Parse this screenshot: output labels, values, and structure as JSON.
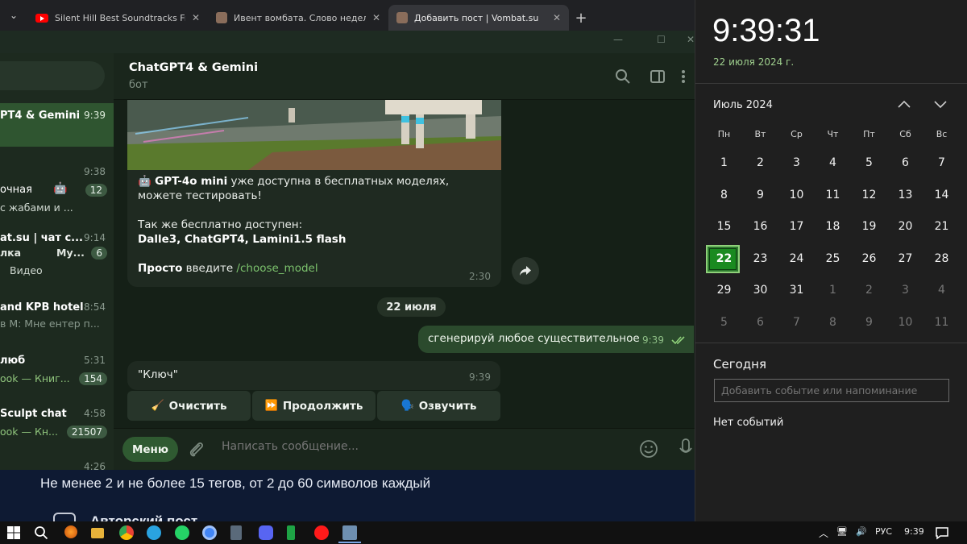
{
  "browser": {
    "tabs": [
      {
        "title": "Silent Hill Best Soundtracks Fro",
        "favicon": "youtube-icon"
      },
      {
        "title": "Ивент вомбата. Слово недели",
        "favicon": "wombat-icon"
      },
      {
        "title": "Добавить пост | Vombat.su",
        "favicon": "wombat-icon",
        "active": true
      }
    ],
    "new_tab": "+"
  },
  "sidebar": {
    "chats": [
      {
        "name": "PT4 & Gemini",
        "time": "9:39",
        "sub": "",
        "badge": "",
        "active": true
      },
      {
        "name": "",
        "time": "9:38",
        "sub": "",
        "badge": ""
      },
      {
        "name": "очная",
        "time": "",
        "sub": "с жабами и ...",
        "badge": "12"
      },
      {
        "name": "at.su | чат с...",
        "time": "9:14",
        "sub": "лка",
        "sub2": "Му...",
        "badge": "6",
        "sub3": "Видео"
      },
      {
        "name": "and KPB hotel",
        "time": "8:54",
        "sub": "в М: Мне ентер п...",
        "badge": ""
      },
      {
        "name": "люб",
        "time": "5:31",
        "sub": "ook — Книг...",
        "badge": "154"
      },
      {
        "name": "Sculpt chat",
        "time": "4:58",
        "sub": "ook — Кн...",
        "badge": "21507"
      },
      {
        "name": "",
        "time": "4:26",
        "sub": "",
        "badge": ""
      }
    ]
  },
  "chat": {
    "title": "ChatGPT4 & Gemini",
    "subtitle": "бот",
    "bot_message": {
      "line1_bold": "GPT-4o mini",
      "line1_rest": " уже доступна в бесплатных моделях, можете тестировать!",
      "line2": "Так же бесплатно доступен:",
      "line3": "Dalle3, ChatGPT4, Lamini1.5 flash",
      "line4_bold": "Просто",
      "line4_mid": " введите ",
      "line4_link": "/choose_model",
      "time": "2:30"
    },
    "date_separator": "22 июля",
    "my_message": {
      "text": "сгенерируй любое существительное",
      "time": "9:39"
    },
    "key_message": {
      "text": "\"Ключ\"",
      "time": "9:39"
    },
    "keyboard": [
      {
        "emoji": "🧹",
        "label": "Очистить"
      },
      {
        "emoji": "⏩",
        "label": "Продолжить"
      },
      {
        "emoji": "🗣️",
        "label": "Озвучить"
      }
    ],
    "composer": {
      "menu": "Меню",
      "placeholder": "Написать сообщение..."
    }
  },
  "webpage": {
    "hint": "Не менее 2 и не более 15 тегов, от 2 до 60 символов каждый",
    "cut_label": "Авторский пост"
  },
  "flyout": {
    "time": "9:39:31",
    "date": "22 июля 2024 г.",
    "month": "Июль 2024",
    "weekdays": [
      "Пн",
      "Вт",
      "Ср",
      "Чт",
      "Пт",
      "Сб",
      "Вс"
    ],
    "weeks": [
      [
        "1",
        "2",
        "3",
        "4",
        "5",
        "6",
        "7"
      ],
      [
        "8",
        "9",
        "10",
        "11",
        "12",
        "13",
        "14"
      ],
      [
        "15",
        "16",
        "17",
        "18",
        "19",
        "20",
        "21"
      ],
      [
        "22",
        "23",
        "24",
        "25",
        "26",
        "27",
        "28"
      ],
      [
        "29",
        "30",
        "31",
        "1",
        "2",
        "3",
        "4"
      ],
      [
        "5",
        "6",
        "7",
        "8",
        "9",
        "10",
        "11"
      ]
    ],
    "today": "22",
    "today_label": "Сегодня",
    "event_placeholder": "Добавить событие или напоминание",
    "no_events": "Нет событий"
  },
  "taskbar": {
    "lang": "РУС",
    "time": "9:39"
  },
  "colors": {
    "accent": "#2f5a31",
    "today": "#1a8a20",
    "date_link": "#9fd08e"
  }
}
